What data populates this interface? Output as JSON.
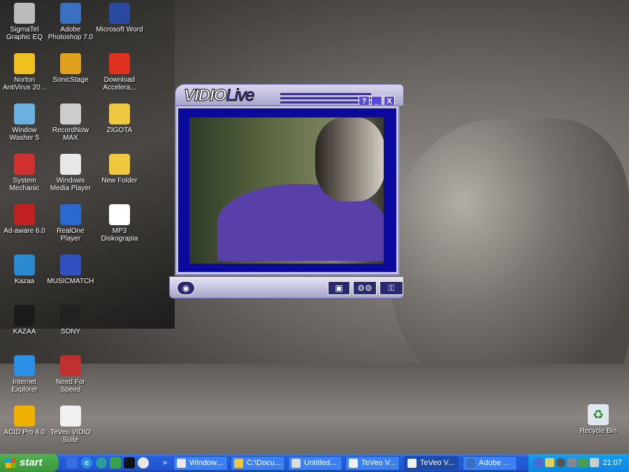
{
  "desktop": {
    "icons": [
      {
        "label": "SigmaTel Graphic EQ",
        "icon": "equalizer-icon"
      },
      {
        "label": "Norton AntiVirus 20...",
        "icon": "norton-icon"
      },
      {
        "label": "Window Washer 5",
        "icon": "magnifier-icon"
      },
      {
        "label": "System Mechanic",
        "icon": "toolbox-icon"
      },
      {
        "label": "Ad-aware 6.0",
        "icon": "adaware-icon"
      },
      {
        "label": "Kazaa",
        "icon": "kazaa-icon"
      },
      {
        "label": "KAZAA",
        "icon": "kazaa-shortcut-icon"
      },
      {
        "label": "Internet Explorer",
        "icon": "internet-explorer-icon"
      },
      {
        "label": "ACID Pro 4.0",
        "icon": "acid-icon"
      },
      {
        "label": "Adobe Photoshop 7.0",
        "icon": "photoshop-icon"
      },
      {
        "label": "SonicStage",
        "icon": "sonicstage-icon"
      },
      {
        "label": "RecordNow MAX",
        "icon": "cd-icon"
      },
      {
        "label": "Windows Media Player",
        "icon": "media-player-icon"
      },
      {
        "label": "RealOne Player",
        "icon": "realone-icon"
      },
      {
        "label": "MUSICMATCH",
        "icon": "musicmatch-icon"
      },
      {
        "label": "SONY",
        "icon": "sony-icon"
      },
      {
        "label": "Need For Speed",
        "icon": "game-icon"
      },
      {
        "label": "TeVeo VIDIO Suite",
        "icon": "teveo-icon"
      },
      {
        "label": "Microsoft Word",
        "icon": "word-icon"
      },
      {
        "label": "Download Accelera...",
        "icon": "download-accelerator-icon"
      },
      {
        "label": "ZIGOTA",
        "icon": "folder-icon"
      },
      {
        "label": "New Folder",
        "icon": "folder-icon"
      },
      {
        "label": "MP3 Diskograpia",
        "icon": "word-document-icon"
      }
    ],
    "recycle_bin": "Recycle Bin"
  },
  "vidio_window": {
    "logo": "VIDIO",
    "logo_suffix": "Live",
    "help": "?",
    "minimize": "_",
    "close": "X"
  },
  "taskbar": {
    "start": "start",
    "chevron": "»",
    "tasks": [
      {
        "label": "Window...",
        "icon": "media-player-icon"
      },
      {
        "label": "C:\\Docu...",
        "icon": "folder-icon"
      },
      {
        "label": "Untitled...",
        "icon": "paint-icon"
      },
      {
        "label": "TeVeo V...",
        "icon": "teveo-icon"
      },
      {
        "label": "TeVeo V...",
        "icon": "teveo-icon",
        "active": true
      },
      {
        "label": "Adobe ...",
        "icon": "photoshop-icon"
      }
    ],
    "clock": "21:07"
  }
}
